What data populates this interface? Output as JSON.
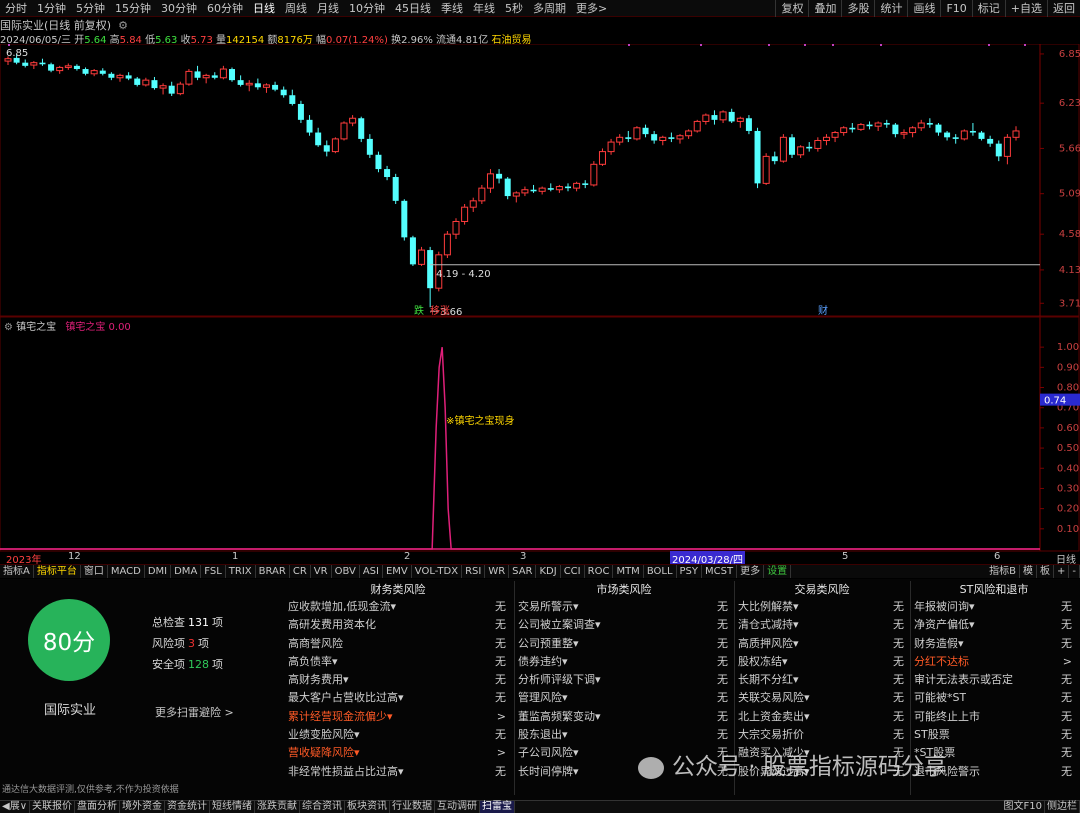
{
  "toolbar": {
    "periods": [
      "分时",
      "1分钟",
      "5分钟",
      "15分钟",
      "30分钟",
      "60分钟",
      "日线",
      "周线",
      "月线",
      "10分钟",
      "45日线",
      "季线",
      "年线",
      "5秒",
      "多周期",
      "更多>"
    ],
    "active_period": "日线",
    "right_buttons": [
      "复权",
      "叠加",
      "多股",
      "统计",
      "画线",
      "F10",
      "标记",
      "+自选",
      "返回"
    ]
  },
  "quote": {
    "title": "国际实业(日线 前复权)",
    "date": "2024/06/05/三",
    "open_label": "开",
    "open": "5.64",
    "high_label": "高",
    "high": "5.84",
    "low_label": "低",
    "low": "5.63",
    "close_label": "收",
    "close": "5.73",
    "volume_label": "量",
    "volume": "142154",
    "amount_label": "额",
    "amount": "8176万",
    "change_label": "幅",
    "change": "0.07(1.24%)",
    "turnover_label": "换",
    "turnover": "2.96%",
    "float_label": "流通",
    "float": "4.81亿",
    "sector": "石油贸易",
    "high_marker": "6.85"
  },
  "price_axis": [
    "6.85",
    "6.23",
    "5.66",
    "5.09",
    "4.58",
    "4.13",
    "3.71"
  ],
  "annotations": {
    "range_label": "4.19 - 4.20",
    "low_label": "3.66",
    "marker_die": "跌",
    "marker_zhang": "移涨",
    "marker_cai": "财"
  },
  "indicator": {
    "name": "镇宅之宝",
    "series_label": "镇宅之宝",
    "value": "0.00",
    "signal_text": "镇宅之宝现身",
    "axis": [
      "1.00",
      "0.90",
      "0.80",
      "0.70",
      "0.60",
      "0.50",
      "0.40",
      "0.30",
      "0.20",
      "0.10"
    ],
    "current": "0.74",
    "spike": 1.0
  },
  "time_axis": {
    "labels": [
      "2023年",
      "12",
      "1",
      "2",
      "3",
      "2024/03/28/四",
      "5",
      "6"
    ],
    "right": "日线"
  },
  "indicator_tabs": [
    "指标A",
    "指标平台",
    "窗口",
    "MACD",
    "DMI",
    "DMA",
    "FSL",
    "TRIX",
    "BRAR",
    "CR",
    "VR",
    "OBV",
    "ASI",
    "EMV",
    "VOL-TDX",
    "RSI",
    "WR",
    "SAR",
    "KDJ",
    "CCI",
    "ROC",
    "MTM",
    "BOLL",
    "PSY",
    "MCST",
    "更多",
    "设置"
  ],
  "indicator_tabs_right": [
    "指标B",
    "模",
    "板",
    "+",
    "-"
  ],
  "risk": {
    "score": "80分",
    "company": "国际实业",
    "total_label": "总检查",
    "total": "131",
    "total_unit": "项",
    "risk_label": "风险项",
    "risk_count": "3",
    "risk_unit": "项",
    "safe_label": "安全项",
    "safe_count": "128",
    "safe_unit": "项",
    "more": "更多扫雷避险 >",
    "disclaimer": "通达信大数据评测,仅供参考,不作为投资依据",
    "columns": [
      {
        "title": "财务类风险",
        "items": [
          [
            "应收款增加,低现金流▾",
            "无"
          ],
          [
            "高研发费用资本化",
            "无"
          ],
          [
            "高商誉风险",
            "无"
          ],
          [
            "高负债率▾",
            "无"
          ],
          [
            "高财务费用▾",
            "无"
          ],
          [
            "最大客户占营收比过高▾",
            "无"
          ],
          [
            "累计经营现金流偏少▾",
            ">"
          ],
          [
            "业绩变脸风险▾",
            "无"
          ],
          [
            "营收疑降风险▾",
            ">"
          ],
          [
            "非经常性损益占比过高▾",
            "无"
          ]
        ],
        "alerts": [
          6,
          8
        ]
      },
      {
        "title": "市场类风险",
        "items": [
          [
            "交易所警示▾",
            "无"
          ],
          [
            "公司被立案调查▾",
            "无"
          ],
          [
            "公司预重整▾",
            "无"
          ],
          [
            "债券违约▾",
            "无"
          ],
          [
            "分析师评级下调▾",
            "无"
          ],
          [
            "管理风险▾",
            "无"
          ],
          [
            "董监高频繁变动▾",
            "无"
          ],
          [
            "股东退出▾",
            "无"
          ],
          [
            "子公司风险▾",
            "无"
          ],
          [
            "长时间停牌▾",
            "无"
          ]
        ],
        "alerts": []
      },
      {
        "title": "交易类风险",
        "items": [
          [
            "大比例解禁▾",
            "无"
          ],
          [
            "清仓式减持▾",
            "无"
          ],
          [
            "高质押风险▾",
            "无"
          ],
          [
            "股权冻结▾",
            "无"
          ],
          [
            "长期不分红▾",
            "无"
          ],
          [
            "关联交易风险▾",
            "无"
          ],
          [
            "北上资金卖出▾",
            "无"
          ],
          [
            "大宗交易折价",
            "无"
          ],
          [
            "融资买入减少▾",
            "无"
          ],
          [
            "股价异动过高▾",
            "无"
          ]
        ],
        "alerts": []
      },
      {
        "title": "ST风险和退市",
        "items": [
          [
            "年报被问询▾",
            "无"
          ],
          [
            "净资产偏低▾",
            "无"
          ],
          [
            "财务造假▾",
            "无"
          ],
          [
            "分红不达标",
            ">"
          ],
          [
            "审计无法表示或否定",
            "无"
          ],
          [
            "可能被*ST",
            "无"
          ],
          [
            "可能终止上市",
            "无"
          ],
          [
            "ST股票",
            "无"
          ],
          [
            "*ST股票",
            "无"
          ],
          [
            "退市风险警示",
            "无"
          ]
        ],
        "alerts": [
          3
        ]
      }
    ]
  },
  "watermark": "公众号 · 股票指标源码分享",
  "bottom_tabs": [
    "◀展∨",
    "关联报价",
    "盘面分析",
    "境外资金",
    "资金统计",
    "短线情绪",
    "涨跌贡献",
    "综合资讯",
    "板块资讯",
    "行业数据",
    "互动调研",
    "扫雷宝"
  ],
  "bottom_active": "扫雷宝",
  "bottom_right": [
    "图文F10",
    "侧边栏"
  ],
  "colors": {
    "up": "#ff3c3c",
    "down": "#54ffff",
    "bg": "#000000",
    "grid": "#4a0a0a",
    "signal": "#e0207a",
    "score": "#27b35a"
  },
  "chart_data": {
    "type": "candlestick",
    "title": "国际实业(日线 前复权)",
    "y_range": [
      3.6,
      6.95
    ],
    "candles": [
      [
        6.76,
        6.82,
        6.71,
        6.79
      ],
      [
        6.8,
        6.85,
        6.72,
        6.74
      ],
      [
        6.74,
        6.78,
        6.68,
        6.7
      ],
      [
        6.71,
        6.76,
        6.66,
        6.74
      ],
      [
        6.74,
        6.79,
        6.7,
        6.72
      ],
      [
        6.72,
        6.74,
        6.62,
        6.64
      ],
      [
        6.64,
        6.7,
        6.6,
        6.68
      ],
      [
        6.68,
        6.73,
        6.65,
        6.7
      ],
      [
        6.7,
        6.72,
        6.64,
        6.66
      ],
      [
        6.66,
        6.68,
        6.58,
        6.6
      ],
      [
        6.6,
        6.66,
        6.57,
        6.64
      ],
      [
        6.64,
        6.67,
        6.58,
        6.6
      ],
      [
        6.6,
        6.62,
        6.52,
        6.55
      ],
      [
        6.55,
        6.6,
        6.5,
        6.58
      ],
      [
        6.58,
        6.62,
        6.52,
        6.54
      ],
      [
        6.54,
        6.56,
        6.44,
        6.46
      ],
      [
        6.46,
        6.55,
        6.44,
        6.52
      ],
      [
        6.52,
        6.56,
        6.4,
        6.42
      ],
      [
        6.42,
        6.48,
        6.34,
        6.45
      ],
      [
        6.45,
        6.5,
        6.32,
        6.35
      ],
      [
        6.35,
        6.5,
        6.33,
        6.47
      ],
      [
        6.47,
        6.66,
        6.45,
        6.63
      ],
      [
        6.63,
        6.7,
        6.52,
        6.55
      ],
      [
        6.55,
        6.6,
        6.48,
        6.58
      ],
      [
        6.58,
        6.62,
        6.53,
        6.55
      ],
      [
        6.55,
        6.7,
        6.53,
        6.66
      ],
      [
        6.66,
        6.68,
        6.5,
        6.52
      ],
      [
        6.52,
        6.58,
        6.44,
        6.46
      ],
      [
        6.46,
        6.52,
        6.38,
        6.48
      ],
      [
        6.48,
        6.54,
        6.4,
        6.43
      ],
      [
        6.43,
        6.48,
        6.36,
        6.46
      ],
      [
        6.46,
        6.5,
        6.38,
        6.4
      ],
      [
        6.4,
        6.44,
        6.3,
        6.33
      ],
      [
        6.33,
        6.4,
        6.2,
        6.22
      ],
      [
        6.22,
        6.26,
        5.98,
        6.02
      ],
      [
        6.02,
        6.08,
        5.82,
        5.86
      ],
      [
        5.86,
        5.92,
        5.68,
        5.7
      ],
      [
        5.7,
        5.76,
        5.56,
        5.62
      ],
      [
        5.62,
        5.8,
        5.6,
        5.78
      ],
      [
        5.78,
        6.0,
        5.76,
        5.98
      ],
      [
        5.98,
        6.08,
        5.94,
        6.04
      ],
      [
        6.04,
        6.06,
        5.74,
        5.78
      ],
      [
        5.78,
        5.84,
        5.54,
        5.58
      ],
      [
        5.58,
        5.62,
        5.36,
        5.4
      ],
      [
        5.4,
        5.44,
        5.26,
        5.3
      ],
      [
        5.3,
        5.34,
        4.96,
        5.0
      ],
      [
        5.0,
        5.02,
        4.5,
        4.54
      ],
      [
        4.54,
        4.56,
        4.18,
        4.2
      ],
      [
        4.2,
        4.42,
        4.18,
        4.38
      ],
      [
        4.38,
        4.42,
        3.66,
        3.9
      ],
      [
        3.9,
        4.36,
        3.86,
        4.32
      ],
      [
        4.32,
        4.62,
        4.28,
        4.58
      ],
      [
        4.58,
        4.78,
        4.52,
        4.74
      ],
      [
        4.74,
        4.96,
        4.7,
        4.92
      ],
      [
        4.92,
        5.04,
        4.86,
        5.0
      ],
      [
        5.0,
        5.2,
        4.96,
        5.16
      ],
      [
        5.16,
        5.4,
        5.1,
        5.34
      ],
      [
        5.34,
        5.4,
        5.22,
        5.28
      ],
      [
        5.28,
        5.3,
        5.02,
        5.06
      ],
      [
        5.06,
        5.12,
        4.98,
        5.1
      ],
      [
        5.1,
        5.18,
        5.06,
        5.14
      ],
      [
        5.14,
        5.2,
        5.1,
        5.12
      ],
      [
        5.12,
        5.18,
        5.08,
        5.16
      ],
      [
        5.16,
        5.22,
        5.12,
        5.14
      ],
      [
        5.14,
        5.2,
        5.1,
        5.18
      ],
      [
        5.18,
        5.22,
        5.12,
        5.16
      ],
      [
        5.16,
        5.24,
        5.12,
        5.22
      ],
      [
        5.22,
        5.26,
        5.16,
        5.2
      ],
      [
        5.2,
        5.5,
        5.18,
        5.46
      ],
      [
        5.46,
        5.66,
        5.44,
        5.62
      ],
      [
        5.62,
        5.78,
        5.58,
        5.74
      ],
      [
        5.74,
        5.84,
        5.7,
        5.8
      ],
      [
        5.8,
        5.88,
        5.74,
        5.78
      ],
      [
        5.78,
        5.94,
        5.76,
        5.92
      ],
      [
        5.92,
        5.96,
        5.8,
        5.84
      ],
      [
        5.84,
        5.88,
        5.72,
        5.76
      ],
      [
        5.76,
        5.82,
        5.7,
        5.8
      ],
      [
        5.8,
        5.86,
        5.74,
        5.78
      ],
      [
        5.78,
        5.84,
        5.72,
        5.82
      ],
      [
        5.82,
        5.9,
        5.78,
        5.88
      ],
      [
        5.88,
        6.02,
        5.86,
        6.0
      ],
      [
        6.0,
        6.1,
        5.96,
        6.08
      ],
      [
        6.08,
        6.14,
        5.96,
        6.02
      ],
      [
        6.02,
        6.14,
        5.98,
        6.12
      ],
      [
        6.12,
        6.16,
        5.98,
        6.0
      ],
      [
        6.0,
        6.06,
        5.92,
        6.04
      ],
      [
        6.04,
        6.08,
        5.84,
        5.88
      ],
      [
        5.88,
        5.92,
        5.16,
        5.22
      ],
      [
        5.22,
        5.6,
        5.2,
        5.56
      ],
      [
        5.56,
        5.62,
        5.46,
        5.5
      ],
      [
        5.5,
        5.84,
        5.48,
        5.8
      ],
      [
        5.8,
        5.84,
        5.54,
        5.58
      ],
      [
        5.58,
        5.7,
        5.54,
        5.68
      ],
      [
        5.68,
        5.74,
        5.62,
        5.66
      ],
      [
        5.66,
        5.8,
        5.62,
        5.76
      ],
      [
        5.76,
        5.84,
        5.7,
        5.8
      ],
      [
        5.8,
        5.88,
        5.74,
        5.86
      ],
      [
        5.86,
        5.94,
        5.82,
        5.92
      ],
      [
        5.92,
        5.98,
        5.86,
        5.9
      ],
      [
        5.9,
        5.98,
        5.88,
        5.96
      ],
      [
        5.96,
        6.0,
        5.9,
        5.94
      ],
      [
        5.94,
        6.0,
        5.88,
        5.98
      ],
      [
        5.98,
        6.02,
        5.92,
        5.96
      ],
      [
        5.96,
        5.98,
        5.8,
        5.84
      ],
      [
        5.84,
        5.9,
        5.78,
        5.86
      ],
      [
        5.86,
        5.94,
        5.8,
        5.92
      ],
      [
        5.92,
        6.02,
        5.88,
        5.98
      ],
      [
        5.98,
        6.04,
        5.92,
        5.96
      ],
      [
        5.96,
        5.98,
        5.82,
        5.86
      ],
      [
        5.86,
        5.88,
        5.76,
        5.8
      ],
      [
        5.8,
        5.84,
        5.72,
        5.78
      ],
      [
        5.78,
        5.9,
        5.76,
        5.88
      ],
      [
        5.88,
        5.98,
        5.82,
        5.86
      ],
      [
        5.86,
        5.88,
        5.76,
        5.78
      ],
      [
        5.78,
        5.82,
        5.68,
        5.72
      ],
      [
        5.72,
        5.76,
        5.5,
        5.56
      ],
      [
        5.56,
        5.84,
        5.46,
        5.8
      ],
      [
        5.8,
        5.94,
        5.76,
        5.88
      ]
    ],
    "indicator_series": {
      "name": "镇宅之宝",
      "spike_index": 49,
      "spike_value": 1.0
    }
  }
}
